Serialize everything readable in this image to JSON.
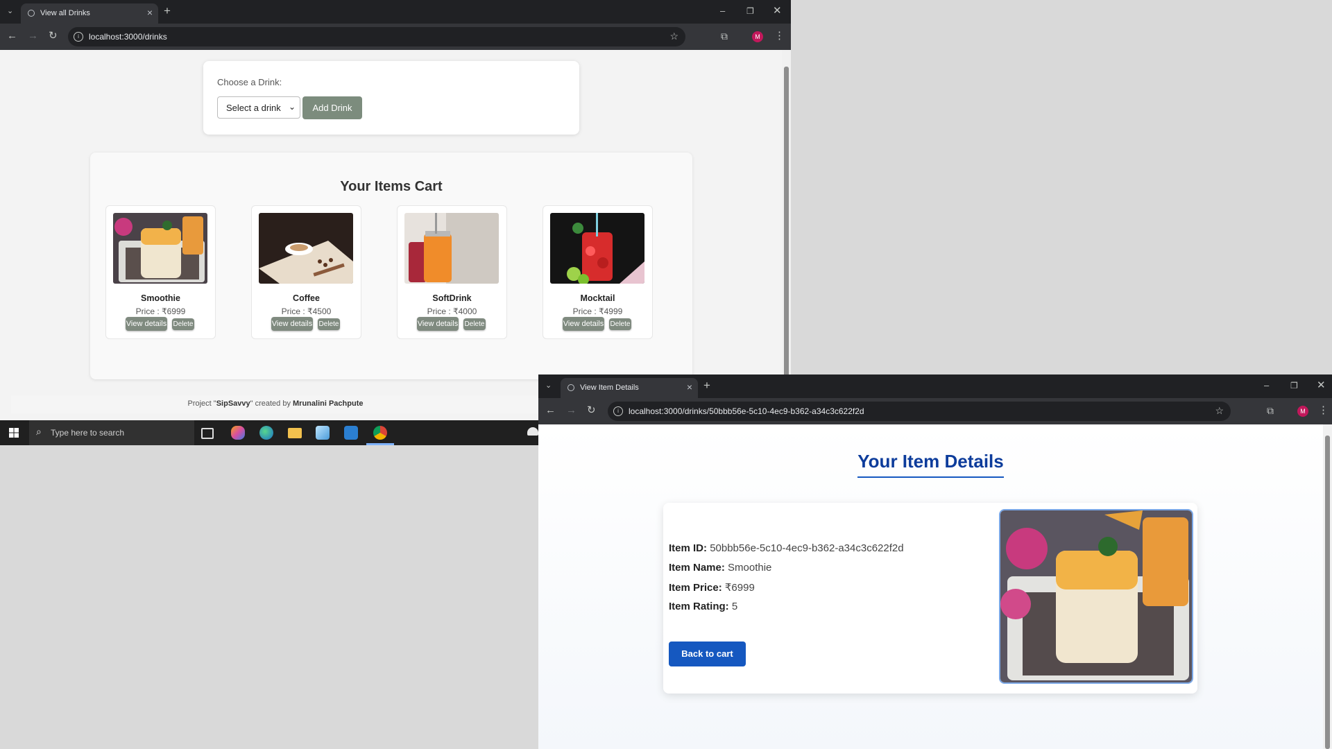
{
  "left_window": {
    "tab_title": "View all Drinks",
    "url": "localhost:3000/drinks",
    "avatar_letter": "M",
    "choose": {
      "label": "Choose a Drink:",
      "select_value": "Select a drink",
      "add_button": "Add Drink"
    },
    "cart": {
      "title": "Your Items Cart",
      "items": [
        {
          "name": "Smoothie",
          "price": "Price : ₹6999",
          "view": "View details",
          "delete": "Delete"
        },
        {
          "name": "Coffee",
          "price": "Price : ₹4500",
          "view": "View details",
          "delete": "Delete"
        },
        {
          "name": "SoftDrink",
          "price": "Price : ₹4000",
          "view": "View details",
          "delete": "Delete"
        },
        {
          "name": "Mocktail",
          "price": "Price : ₹4999",
          "view": "View details",
          "delete": "Delete"
        }
      ]
    },
    "footer": {
      "pre": "Project \"",
      "project": "SipSavvy",
      "mid": "\" created by ",
      "author": "Mrunalini Pachpute"
    }
  },
  "taskbar": {
    "search_placeholder": "Type here to search"
  },
  "right_window": {
    "tab_title": "View Item Details",
    "url": "localhost:3000/drinks/50bbb56e-5c10-4ec9-b362-a34c3c622f2d",
    "avatar_letter": "M",
    "heading": "Your Item Details",
    "fields": [
      {
        "label": "Item ID:",
        "value": "50bbb56e-5c10-4ec9-b362-a34c3c622f2d"
      },
      {
        "label": "Item Name:",
        "value": "Smoothie"
      },
      {
        "label": "Item Price:",
        "value": "₹6999"
      },
      {
        "label": "Item Rating:",
        "value": "5"
      }
    ],
    "back_button": "Back to cart"
  },
  "colors": {
    "accent_blue": "#1558c0",
    "heading_blue": "#0d3c9b",
    "gray_button": "#7c8c7d",
    "chrome_dark": "#202124"
  }
}
